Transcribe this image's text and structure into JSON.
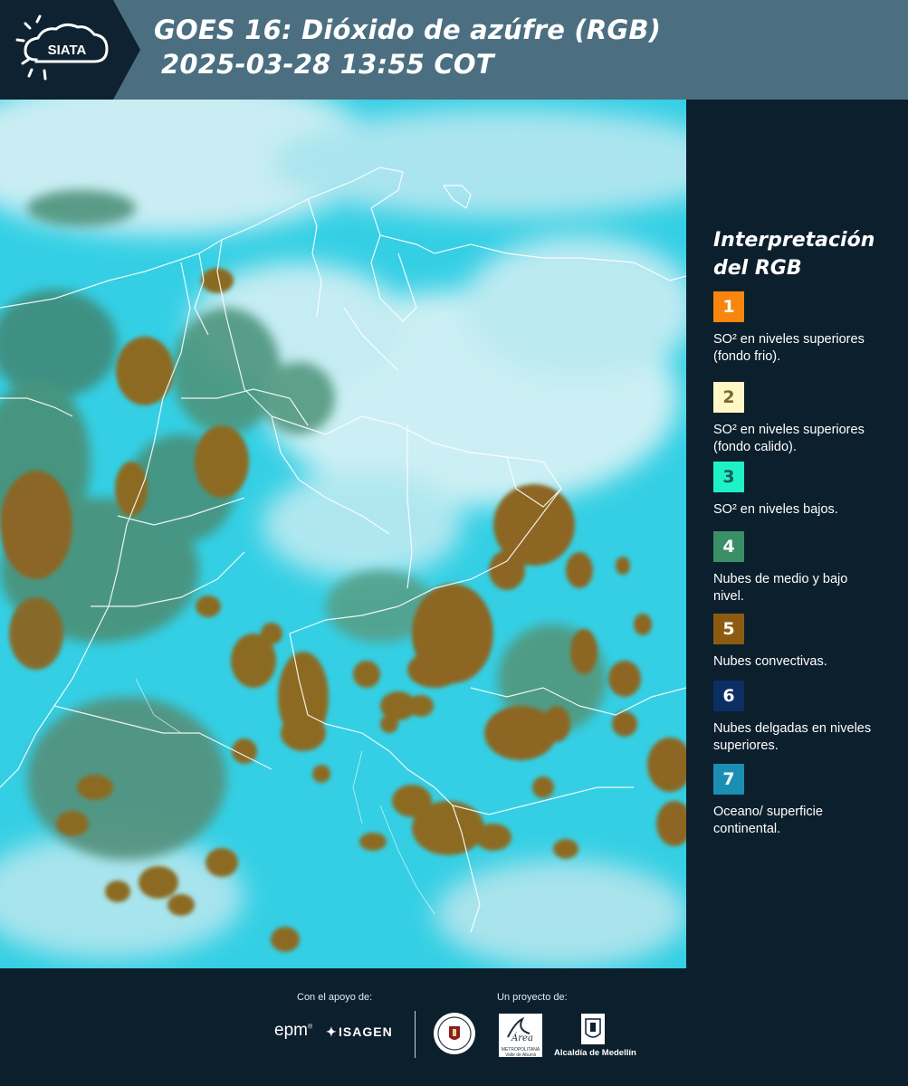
{
  "header": {
    "logo_text": "SIATA",
    "title_line1": "GOES 16: Dióxido de azúfre (RGB)",
    "title_line2": "2025-03-28 13:55 COT"
  },
  "legend": {
    "title_line1": "Interpretación",
    "title_line2": "del RGB",
    "items": [
      {
        "number": "1",
        "color": "#f7860f",
        "text": "SO² en niveles superiores (fondo frio)."
      },
      {
        "number": "2",
        "color": "#fff7c6",
        "text": "SO² en niveles superiores (fondo calido)."
      },
      {
        "number": "3",
        "color": "#1ef2c8",
        "text": "SO² en niveles bajos."
      },
      {
        "number": "4",
        "color": "#3a8f67",
        "text": "Nubes de medio y bajo nivel."
      },
      {
        "number": "5",
        "color": "#8c5b12",
        "text": "Nubes convectivas."
      },
      {
        "number": "6",
        "color": "#0b2e63",
        "text": "Nubes delgadas en niveles superiores."
      },
      {
        "number": "7",
        "color": "#1b8eb3",
        "text": "Oceano/ superficie continental."
      }
    ]
  },
  "footer": {
    "support_label": "Con el apoyo de:",
    "project_label": "Un proyecto de:",
    "epm": "epm",
    "isagen": "ISAGEN",
    "area_text": "METROPOLITANA Valle de Aburrá",
    "alcaldia": "Alcaldía de Medellín"
  },
  "colors": {
    "header_bg": "#4b6f80",
    "panel_bg": "#0c1f2d",
    "cyan_surface": "#35d2e6",
    "high_cloud": "#d8eef3",
    "convective": "#8c6a20",
    "mid_low_cloud": "#3f8a78"
  }
}
